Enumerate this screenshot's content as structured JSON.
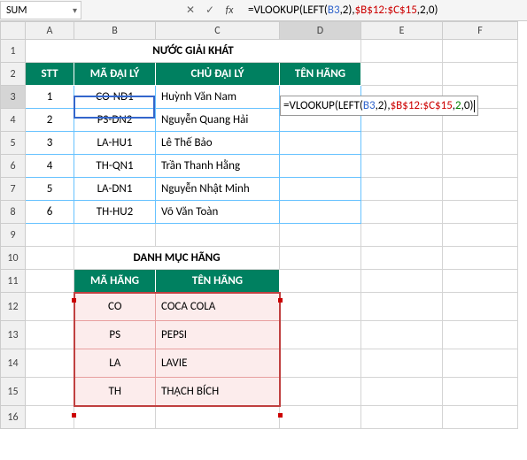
{
  "nameBox": "SUM",
  "fx": {
    "cancel": "✕",
    "enter": "✓",
    "fx": "fx"
  },
  "formulaPlain": "=VLOOKUP(LEFT(B3,2),$B$12:$C$15,2,0)",
  "formulaParts": {
    "p1": "=VLOOKUP(LEFT(",
    "p2": "B3",
    "p3": ",2),",
    "p4": "$B$12:$C$15",
    "p5": ",",
    "p6": "2",
    "p7": ",0)"
  },
  "cols": [
    "A",
    "B",
    "C",
    "D",
    "E",
    "F"
  ],
  "rows": [
    "1",
    "2",
    "3",
    "4",
    "5",
    "6",
    "7",
    "8",
    "9",
    "10",
    "11",
    "12",
    "13",
    "14",
    "15",
    "16"
  ],
  "title1": "NƯỚC GIẢI KHÁT",
  "headers1": {
    "stt": "STT",
    "ma": "MÃ ĐẠI LÝ",
    "chu": "CHỦ ĐẠI LÝ",
    "ten": "TÊN HÃNG"
  },
  "table1": [
    {
      "stt": "1",
      "ma": "CO-ND1",
      "chu": "Huỳnh Văn Nam"
    },
    {
      "stt": "2",
      "ma": "PS-DN2",
      "chu": "Nguyễn Quang Hải"
    },
    {
      "stt": "3",
      "ma": "LA-HU1",
      "chu": "Lê Thế Bảo"
    },
    {
      "stt": "4",
      "ma": "TH-QN1",
      "chu": "Trần Thanh Hằng"
    },
    {
      "stt": "5",
      "ma": "LA-DN1",
      "chu": "Nguyễn Nhật Minh"
    },
    {
      "stt": "6",
      "ma": "TH-HU2",
      "chu": "Võ Văn Toàn"
    }
  ],
  "title2": "DANH MỤC HÃNG",
  "headers2": {
    "ma": "MÃ HÃNG",
    "ten": "TÊN HÃNG"
  },
  "table2": [
    {
      "ma": "CO",
      "ten": "COCA COLA"
    },
    {
      "ma": "PS",
      "ten": "PEPSI"
    },
    {
      "ma": "LA",
      "ten": "LAVIE"
    },
    {
      "ma": "TH",
      "ten": "THẠCH BÍCH"
    }
  ]
}
